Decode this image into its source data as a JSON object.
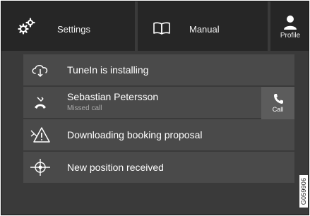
{
  "topbar": {
    "settings": {
      "label": "Settings",
      "icon": "gears-icon"
    },
    "manual": {
      "label": "Manual",
      "icon": "book-icon"
    },
    "profile": {
      "label": "Profile",
      "icon": "person-icon"
    }
  },
  "notifications": [
    {
      "title": "TuneIn is installing",
      "icon": "cloud-download-icon"
    },
    {
      "title": "Sebastian Petersson",
      "subtitle": "Missed call",
      "icon": "missed-call-icon",
      "action_label": "Call",
      "action_icon": "phone-icon"
    },
    {
      "title": "Downloading booking proposal",
      "icon": "service-warning-icon"
    },
    {
      "title": "New position received",
      "icon": "map-position-icon"
    }
  ],
  "image_code": "G059906",
  "colors": {
    "background": "#3a3a3a",
    "topbar": "#262626",
    "row": "#4a4a4a",
    "action": "#5c5c5c",
    "text": "#ffffff",
    "subtext": "#a8a8a8"
  }
}
